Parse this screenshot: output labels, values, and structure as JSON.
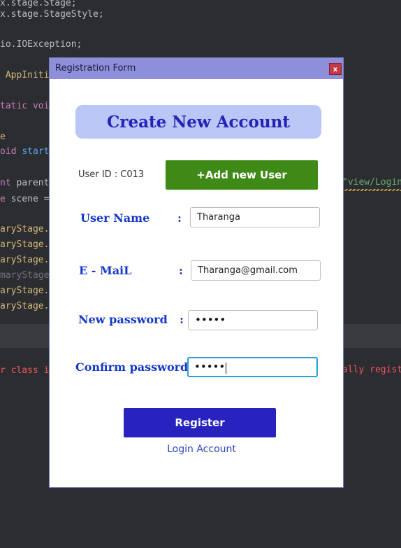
{
  "editor": {
    "lines": [
      {
        "a": "x.stage.Stage;",
        "cls": "pl"
      },
      {
        "a": "x.stage.StageStyle;",
        "cls": "pl"
      },
      {
        "a": "io.IOException;",
        "cls": "pl"
      },
      {
        "a": " AppInitia",
        "cls": "yl"
      },
      {
        "a": "tatic voic",
        "cls": "kw"
      },
      {
        "a": "e",
        "cls": "yl"
      },
      {
        "a": "oid ",
        "cls": "kw",
        "b": "start(",
        "bcls": "fn"
      },
      {
        "a": "nt ",
        "cls": "kw",
        "b": "parent ",
        "bcls": "pl"
      },
      {
        "a": "e ",
        "cls": "kw",
        "b": "scene =",
        "bcls": "pl"
      },
      {
        "a": "aryStage.s",
        "cls": "yl"
      },
      {
        "a": "aryStage.s",
        "cls": "yl"
      },
      {
        "a": "aryStage.c",
        "cls": "yl"
      },
      {
        "a": "maryStage.",
        "cls": "dim"
      },
      {
        "a": "aryStage.i",
        "cls": "yl"
      },
      {
        "a": "aryStage.s",
        "cls": "yl"
      },
      {
        "a": "r class is",
        "cls": "cm"
      }
    ],
    "right_string": "\"view/Login",
    "right_error": "ally regist"
  },
  "window": {
    "title": "Registration Form",
    "close": "x"
  },
  "form": {
    "header": "Create New Account",
    "user_id": "User ID : C013",
    "add_button": "+Add new User",
    "username_label": "User Name",
    "username_value": "Tharanga",
    "email_label": "E - MaiL",
    "email_value": "Tharanga@gmail.com",
    "newpass_label": "New password",
    "newpass_value": "•••••",
    "confirm_label": "Confirm password :",
    "confirm_value": "•••••",
    "colon": ":",
    "register_button": "Register",
    "login_link": "Login Account"
  }
}
